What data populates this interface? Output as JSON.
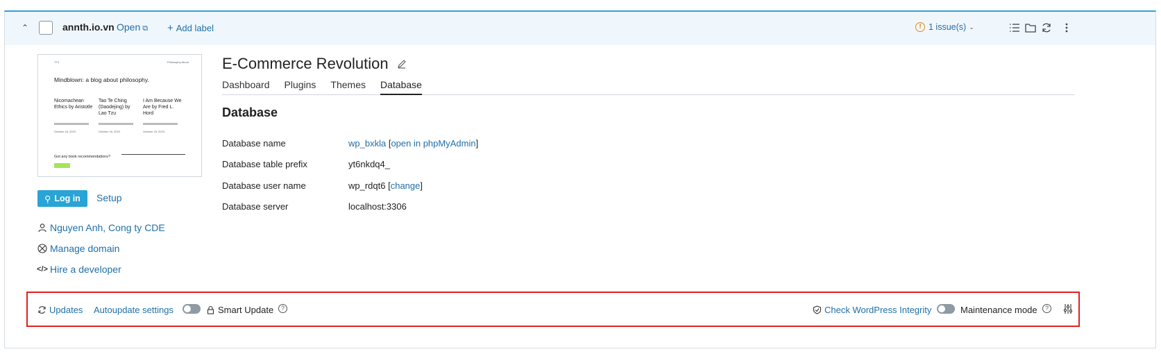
{
  "topbar": {
    "site_name": "annth.io.vn",
    "open_label": "Open",
    "add_label": "Add label",
    "issues_label": "1 issue(s)"
  },
  "thumbnail": {
    "nav_left": "TT4",
    "nav_right": "Mindblown: a blog about philosophy.",
    "nav_links": "Philosophy  About",
    "columns": [
      {
        "title": "Nicomachean Ethics by Aristotle",
        "date": "October 18, 2023"
      },
      {
        "title": "Tao Te Ching (Daodejing) by Lao Tzu",
        "date": "October 18, 2023"
      },
      {
        "title": "I Am Because We Are by Fred L. Hord",
        "date": "October 18, 2023"
      }
    ],
    "question": "Got any book recommendations?"
  },
  "sidebar": {
    "login_label": "Log in",
    "setup_label": "Setup",
    "owner": "Nguyen Anh, Cong ty CDE",
    "manage_domain": "Manage domain",
    "hire_developer": "Hire a developer"
  },
  "main": {
    "title": "E-Commerce Revolution",
    "tabs": [
      "Dashboard",
      "Plugins",
      "Themes",
      "Database"
    ],
    "active_tab": "Database",
    "section_title": "Database",
    "rows": [
      {
        "label": "Database name",
        "value": "wp_bxkla",
        "link": "open in phpMyAdmin"
      },
      {
        "label": "Database table prefix",
        "value": "yt6nkdq4_"
      },
      {
        "label": "Database user name",
        "value": "wp_rdqt6",
        "link": "change"
      },
      {
        "label": "Database server",
        "value": "localhost:3306"
      }
    ]
  },
  "bottombar": {
    "updates": "Updates",
    "autoupdate": "Autoupdate settings",
    "smart_update": "Smart Update",
    "check_integrity": "Check WordPress Integrity",
    "maintenance": "Maintenance mode"
  }
}
